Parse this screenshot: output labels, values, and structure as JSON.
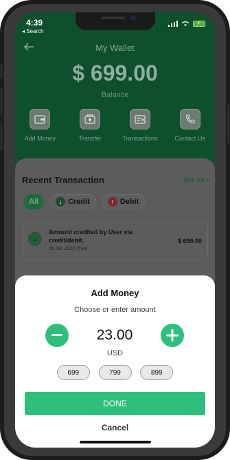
{
  "status_bar": {
    "time": "4:39",
    "back_app": "◂ Search",
    "battery": "⚡"
  },
  "header": {
    "title": "My Wallet",
    "balance": "$ 699.00",
    "balance_label": "Balance"
  },
  "actions": [
    {
      "label": "Add Money",
      "icon": "wallet-icon"
    },
    {
      "label": "Transfer",
      "icon": "transfer-icon"
    },
    {
      "label": "Transactions",
      "icon": "transactions-icon"
    },
    {
      "label": "Contact Us",
      "icon": "phone-icon"
    }
  ],
  "recent": {
    "title": "Recent Transaction",
    "see_all": "See All >",
    "filters": {
      "all": "All",
      "credit": "Credit",
      "debit": "Debit"
    },
    "transaction": {
      "description": "Amount credited by User via credit/debit.",
      "date": "05 Jul, 2022 (Tue)",
      "amount": "$ 699.00"
    }
  },
  "add_money": {
    "title": "Add Money",
    "subtitle": "Choose or enter amount",
    "amount": "23.00",
    "currency": "USD",
    "presets": [
      "699",
      "799",
      "899"
    ],
    "done_label": "DONE",
    "cancel_label": "Cancel"
  },
  "colors": {
    "accent": "#2fbf7d",
    "header": "#0e4f2c"
  }
}
